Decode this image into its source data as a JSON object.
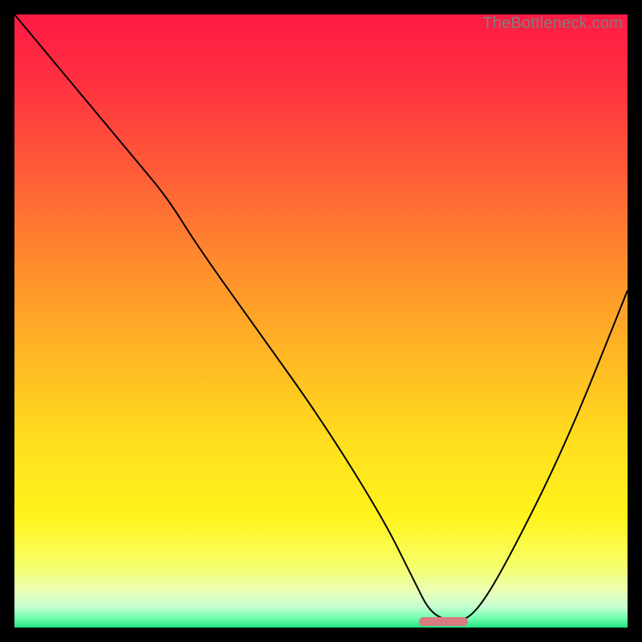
{
  "watermark": "TheBottleneck.com",
  "chart_data": {
    "type": "line",
    "title": "",
    "xlabel": "",
    "ylabel": "",
    "xlim": [
      0,
      100
    ],
    "ylim": [
      0,
      100
    ],
    "grid": false,
    "legend": false,
    "background_gradient_stops": [
      {
        "offset": 0.0,
        "color": "#ff1a44"
      },
      {
        "offset": 0.1,
        "color": "#ff2e41"
      },
      {
        "offset": 0.25,
        "color": "#ff5a38"
      },
      {
        "offset": 0.4,
        "color": "#ff8a2e"
      },
      {
        "offset": 0.55,
        "color": "#ffb524"
      },
      {
        "offset": 0.7,
        "color": "#ffdf1e"
      },
      {
        "offset": 0.82,
        "color": "#fff31c"
      },
      {
        "offset": 0.9,
        "color": "#f6ff6a"
      },
      {
        "offset": 0.94,
        "color": "#eaffb5"
      },
      {
        "offset": 0.965,
        "color": "#c8ffd0"
      },
      {
        "offset": 0.985,
        "color": "#6fffb0"
      },
      {
        "offset": 1.0,
        "color": "#24e07f"
      }
    ],
    "series": [
      {
        "name": "bottleneck-curve",
        "color": "#000000",
        "x": [
          0,
          10,
          20,
          25,
          30,
          40,
          50,
          60,
          65,
          68,
          72,
          75,
          80,
          90,
          100
        ],
        "y": [
          100,
          88,
          76,
          70,
          62,
          48,
          34,
          18,
          8,
          2,
          1,
          2,
          10,
          30,
          55
        ]
      }
    ],
    "marker": {
      "name": "optimal-marker",
      "color": "#d87a80",
      "x_center": 70,
      "y_center": 1,
      "width_pct": 8,
      "height_pct": 1.4
    }
  }
}
